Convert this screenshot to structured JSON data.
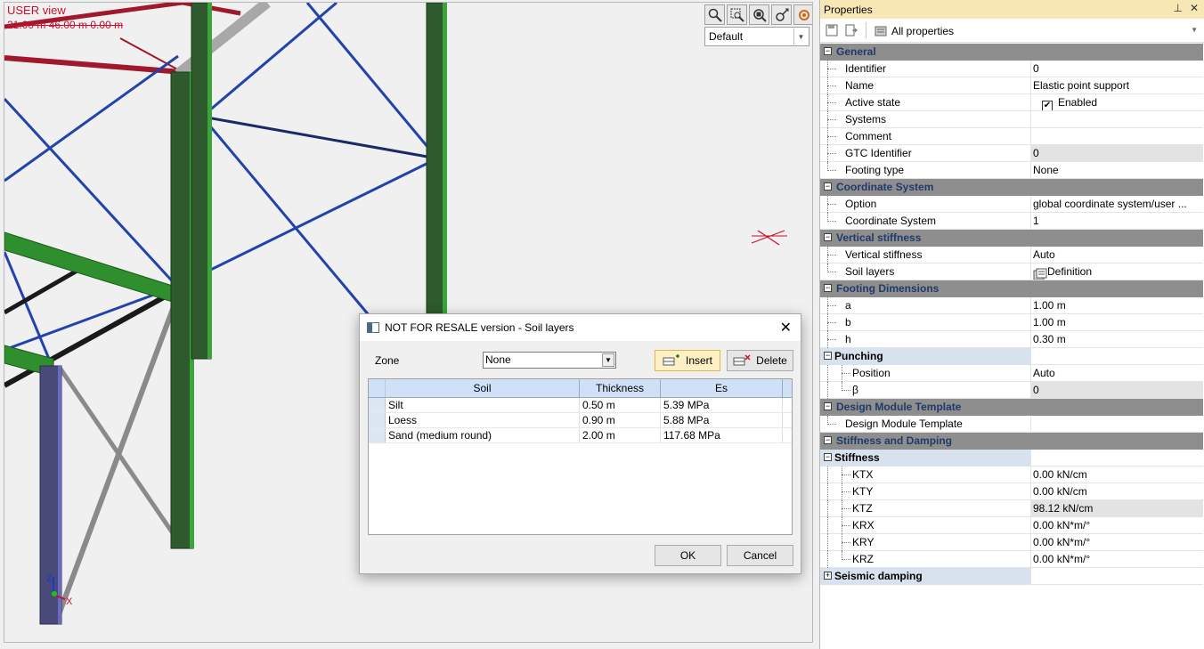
{
  "viewport": {
    "title": "USER view",
    "coords": "21.00 m  46.00 m  0.00 m",
    "view_combo": "Default",
    "axis_z": "Z",
    "axis_x": "X"
  },
  "properties": {
    "title": "Properties",
    "filter": "All properties",
    "rows": [
      {
        "kind": "cat",
        "label": "General"
      },
      {
        "kind": "item",
        "label": "Identifier",
        "value": "0"
      },
      {
        "kind": "item",
        "label": "Name",
        "value": "Elastic point support"
      },
      {
        "kind": "check",
        "label": "Active state",
        "value": "Enabled"
      },
      {
        "kind": "item",
        "label": "Systems",
        "value": ""
      },
      {
        "kind": "item",
        "label": "Comment",
        "value": ""
      },
      {
        "kind": "item",
        "label": "GTC Identifier",
        "value": "0",
        "grey": true
      },
      {
        "kind": "item",
        "label": "Footing type",
        "value": "None",
        "last": true
      },
      {
        "kind": "cat",
        "label": "Coordinate System"
      },
      {
        "kind": "item",
        "label": "Option",
        "value": "global coordinate system/user ..."
      },
      {
        "kind": "item",
        "label": "Coordinate System",
        "value": "1",
        "last": true
      },
      {
        "kind": "cat",
        "label": "Vertical stiffness"
      },
      {
        "kind": "item",
        "label": "Vertical stiffness",
        "value": "Auto"
      },
      {
        "kind": "def",
        "label": "Soil layers",
        "value": "Definition",
        "last": true
      },
      {
        "kind": "cat",
        "label": "Footing Dimensions"
      },
      {
        "kind": "item",
        "label": "a",
        "value": "1.00 m"
      },
      {
        "kind": "item",
        "label": "b",
        "value": "1.00 m"
      },
      {
        "kind": "item",
        "label": "h",
        "value": "0.30 m"
      },
      {
        "kind": "sub",
        "label": "Punching",
        "value": ""
      },
      {
        "kind": "l2",
        "label": "Position",
        "value": "Auto"
      },
      {
        "kind": "l2",
        "label": "β",
        "value": "0",
        "grey": true,
        "last": true
      },
      {
        "kind": "cat",
        "label": "Design Module Template"
      },
      {
        "kind": "item",
        "label": "Design Module Template",
        "value": "",
        "last": true
      },
      {
        "kind": "cat",
        "label": "Stiffness and Damping"
      },
      {
        "kind": "sub",
        "label": "Stiffness",
        "value": ""
      },
      {
        "kind": "l2",
        "label": "KTX",
        "value": "0.00 kN/cm"
      },
      {
        "kind": "l2",
        "label": "KTY",
        "value": "0.00 kN/cm"
      },
      {
        "kind": "l2",
        "label": "KTZ",
        "value": "98.12 kN/cm",
        "grey": true
      },
      {
        "kind": "l2",
        "label": "KRX",
        "value": "0.00 kN*m/°"
      },
      {
        "kind": "l2",
        "label": "KRY",
        "value": "0.00 kN*m/°"
      },
      {
        "kind": "l2",
        "label": "KRZ",
        "value": "0.00 kN*m/°",
        "last": true
      },
      {
        "kind": "subc",
        "label": "Seismic damping",
        "value": ""
      }
    ]
  },
  "dialog": {
    "title": "NOT FOR RESALE version - Soil layers",
    "zone_label": "Zone",
    "zone_value": "None",
    "insert_label": "Insert",
    "delete_label": "Delete",
    "ok_label": "OK",
    "cancel_label": "Cancel",
    "columns": [
      "Soil",
      "Thickness",
      "Es"
    ],
    "rows": [
      [
        "Silt",
        "0.50 m",
        "5.39 MPa"
      ],
      [
        "Loess",
        "0.90 m",
        "5.88 MPa"
      ],
      [
        "Sand (medium round)",
        "2.00 m",
        "117.68 MPa"
      ]
    ]
  },
  "colors": {
    "accent_red": "#c8102e",
    "category_bg": "#8e8e8e",
    "title_bar": "#f7e7b4",
    "grid_header": "#cfe0f7"
  }
}
